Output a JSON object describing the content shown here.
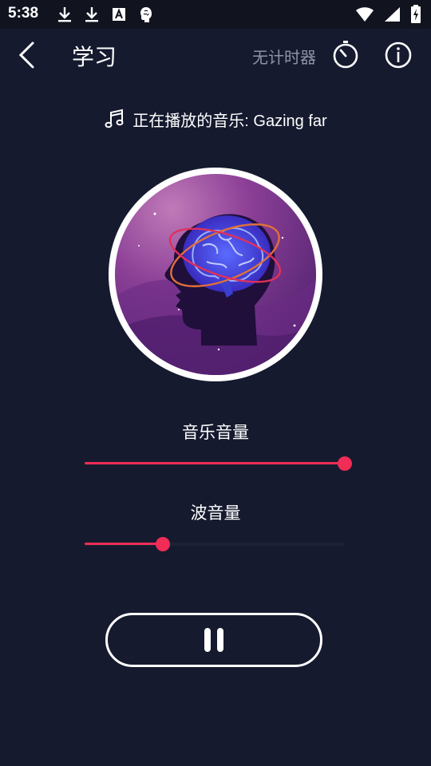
{
  "status_bar": {
    "time": "5:38",
    "left_icons": [
      "download-icon",
      "download-icon",
      "font-icon",
      "brain-app-icon"
    ],
    "right_icons": [
      "wifi-icon",
      "signal-icon",
      "battery-charging-icon"
    ]
  },
  "app_bar": {
    "back_icon": "chevron-left-icon",
    "title": "学习",
    "timer_label": "无计时器",
    "timer_icon": "timer-icon",
    "info_icon": "info-icon"
  },
  "now_playing": {
    "icon": "music-note-icon",
    "text": "正在播放的音乐: Gazing far"
  },
  "artwork": {
    "description_icon": "brain-head-artwork"
  },
  "music_volume": {
    "label": "音乐音量",
    "value": 1.0
  },
  "wave_volume": {
    "label": "波音量",
    "value": 0.3
  },
  "playback": {
    "state_icon": "pause-icon"
  },
  "colors": {
    "background": "#161a2f",
    "accent": "#ef2d56",
    "muted_text": "#8f93a6"
  }
}
